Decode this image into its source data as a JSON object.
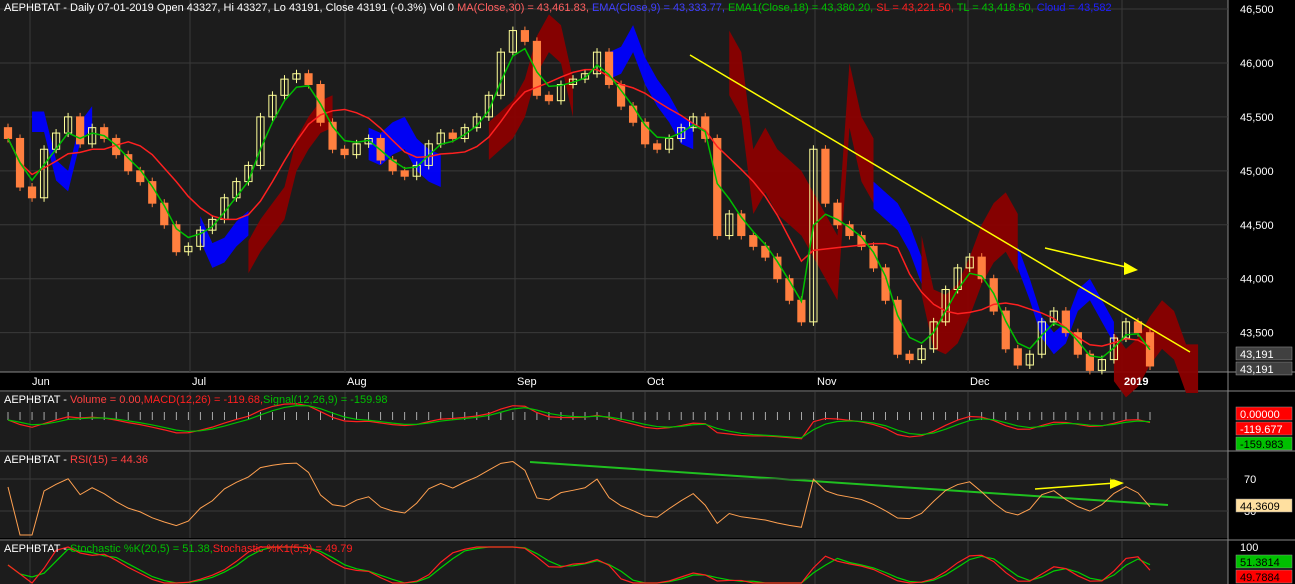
{
  "colors": {
    "background": "#000000",
    "panel": "#1c1c1c",
    "grid": "#3a3a3a",
    "up_candle": "#ffff99",
    "down_candle": "#ff7f3f",
    "ma": "#ff2020",
    "ema9": "#00c000",
    "trendline": "#ffff00",
    "cloud_bull": "#0000ff",
    "cloud_bear": "#8b0000",
    "macd": "#ff2020",
    "signal": "#00c000",
    "rsi": "#ffa050",
    "stoch_k": "#00d000",
    "stoch_k1": "#ff2020"
  },
  "price_panel": {
    "header": [
      {
        "text": "AEPHBTAT - Daily 07-01-2019 Open 43327, Hi 43327, Lo 43191, Close 43191 (-0.3%) Vol 0",
        "color": "#ffffff"
      },
      {
        "text": "MA(Close,30) = 43,461.83,",
        "color": "#ff6060"
      },
      {
        "text": "EMA(Close,9) = 43,333.77,",
        "color": "#4040ff"
      },
      {
        "text": "EMA1(Close,18) = 43,380.20,",
        "color": "#00c000"
      },
      {
        "text": "SL = 43,221.50,",
        "color": "#ff2020"
      },
      {
        "text": "TL = 43,418.50,",
        "color": "#00c000"
      },
      {
        "text": "Cloud = 43,582",
        "color": "#2020ff"
      }
    ],
    "y_ticks": [
      "46,500",
      "46,000",
      "45,500",
      "45,000",
      "44,500",
      "44,000",
      "43,500"
    ],
    "last_price_tags": [
      "43,191",
      "43,191"
    ],
    "x_labels": [
      "Jun",
      "Jul",
      "Aug",
      "Sep",
      "Oct",
      "Nov",
      "Dec",
      "2019"
    ]
  },
  "macd_panel": {
    "label": "AEPHBTAT - ",
    "volume": "Volume = 0.00,",
    "macd": "MACD(12,26) = -119.68,",
    "signal": "Signal(12,26,9) = -159.98",
    "tags": [
      "0.00000",
      "-119.677",
      "-159.983"
    ]
  },
  "rsi_panel": {
    "label": "AEPHBTAT - ",
    "rsi": "RSI(15) = 44.36",
    "y_ticks": [
      "70",
      "30"
    ],
    "tag": "44.3609"
  },
  "stoch_panel": {
    "label": "AEPHBTAT - ",
    "k": "Stochastic %K(20,5) = 51.38,",
    "k1": "Stochastic %K1(5,3) = 49.79",
    "y_ticks": [
      "100"
    ],
    "tags": [
      "51.3814",
      "49.7884"
    ]
  },
  "chart_data": {
    "type": "candlestick",
    "ylim": [
      43200,
      46500
    ],
    "x_labels": [
      "Jun",
      "Jul",
      "Aug",
      "Sep",
      "Oct",
      "Nov",
      "Dec",
      "2019"
    ],
    "closes": [
      45300,
      44850,
      44750,
      45200,
      45350,
      45500,
      45250,
      45400,
      45300,
      45150,
      45000,
      44900,
      44700,
      44500,
      44250,
      44300,
      44450,
      44550,
      44750,
      44900,
      45050,
      45500,
      45700,
      45850,
      45900,
      45800,
      45450,
      45200,
      45150,
      45250,
      45300,
      45100,
      45000,
      44950,
      45050,
      45250,
      45350,
      45300,
      45400,
      45500,
      45700,
      46100,
      46300,
      46200,
      45700,
      45650,
      45800,
      45850,
      45900,
      46100,
      45800,
      45600,
      45450,
      45250,
      45200,
      45300,
      45400,
      45500,
      45300,
      44400,
      44600,
      44400,
      44300,
      44200,
      44000,
      43800,
      43600,
      45200,
      44700,
      44500,
      44400,
      44300,
      44100,
      43800,
      43300,
      43250,
      43350,
      43600,
      43900,
      44100,
      44200,
      44000,
      43700,
      43350,
      43200,
      43300,
      43600,
      43700,
      43500,
      43300,
      43150,
      43250,
      43450,
      43600,
      43500,
      43191
    ]
  }
}
